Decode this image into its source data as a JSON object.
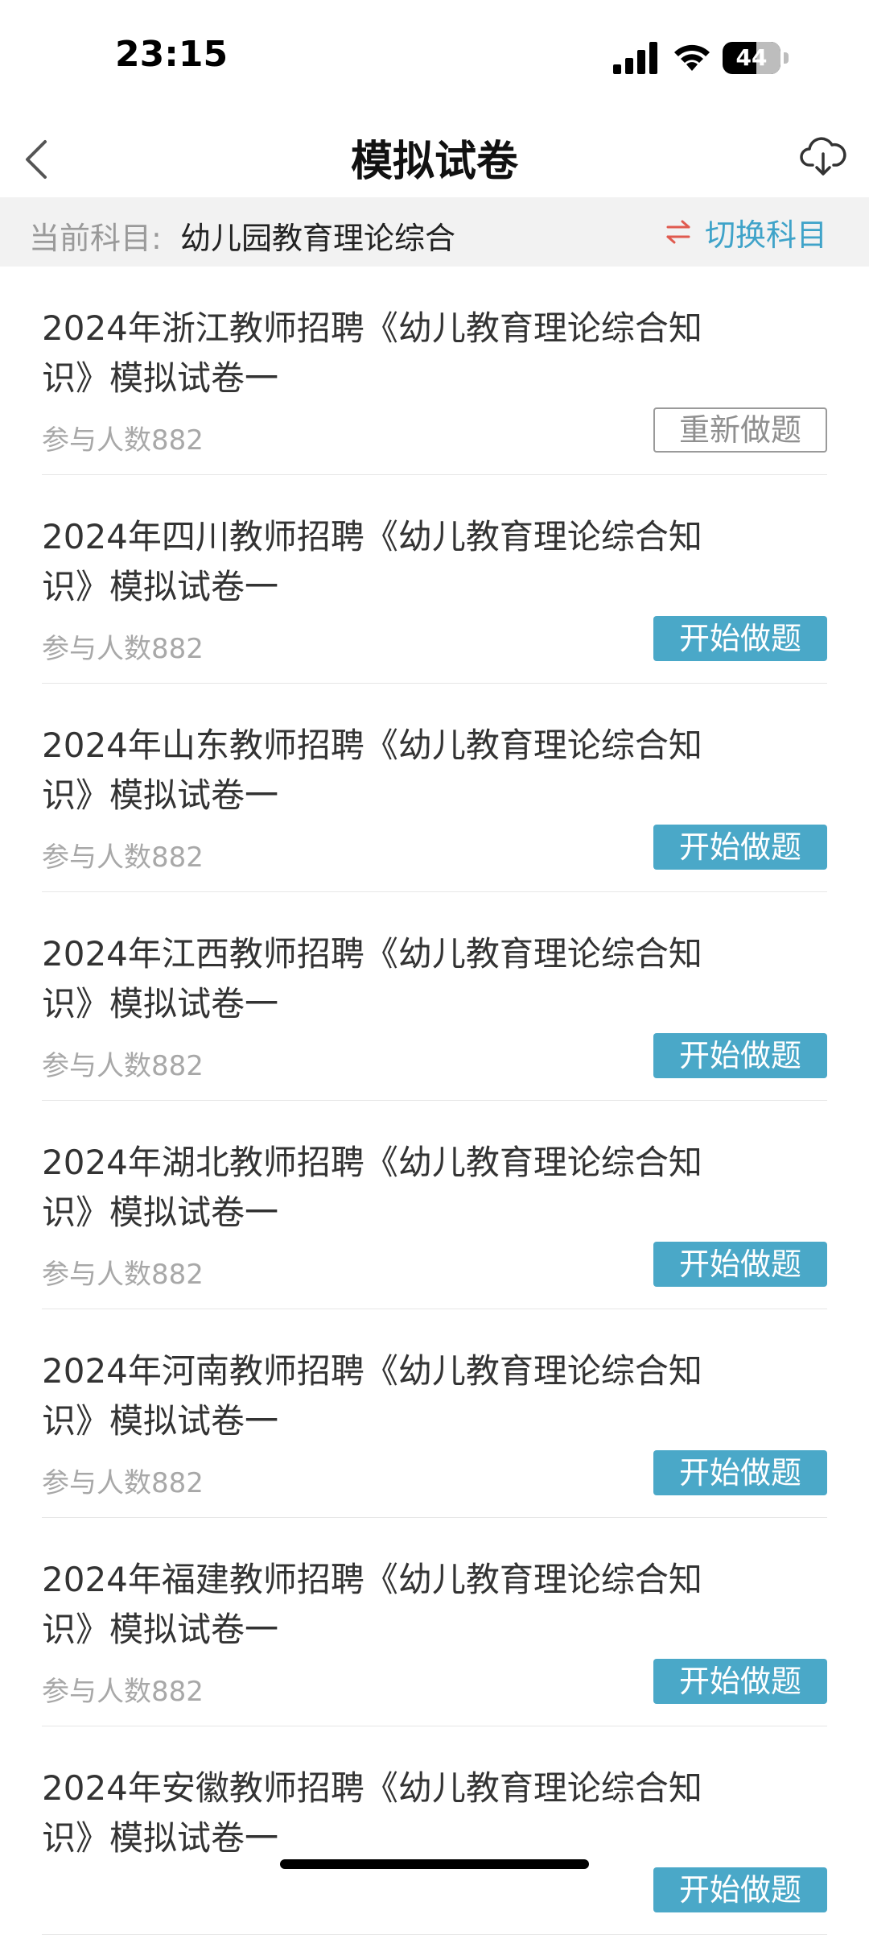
{
  "status_bar": {
    "time": "23:15",
    "battery_percent": "44"
  },
  "nav": {
    "title": "模拟试卷",
    "back_icon": "chevron-left-icon",
    "download_icon": "cloud-download-icon"
  },
  "subject": {
    "label": "当前科目:",
    "value": "幼儿园教育理论综合",
    "switch_label": "切换科目",
    "switch_icon": "swap-arrows-icon"
  },
  "papers": [
    {
      "title": "2024年浙江教师招聘《幼儿教育理论综合知识》模拟试卷一",
      "count": "参与人数882",
      "button": "重新做题",
      "state": "redo"
    },
    {
      "title": "2024年四川教师招聘《幼儿教育理论综合知识》模拟试卷一",
      "count": "参与人数882",
      "button": "开始做题",
      "state": "start"
    },
    {
      "title": "2024年山东教师招聘《幼儿教育理论综合知识》模拟试卷一",
      "count": "参与人数882",
      "button": "开始做题",
      "state": "start"
    },
    {
      "title": "2024年江西教师招聘《幼儿教育理论综合知识》模拟试卷一",
      "count": "参与人数882",
      "button": "开始做题",
      "state": "start"
    },
    {
      "title": "2024年湖北教师招聘《幼儿教育理论综合知识》模拟试卷一",
      "count": "参与人数882",
      "button": "开始做题",
      "state": "start"
    },
    {
      "title": "2024年河南教师招聘《幼儿教育理论综合知识》模拟试卷一",
      "count": "参与人数882",
      "button": "开始做题",
      "state": "start"
    },
    {
      "title": "2024年福建教师招聘《幼儿教育理论综合知识》模拟试卷一",
      "count": "参与人数882",
      "button": "开始做题",
      "state": "start"
    },
    {
      "title": "2024年安徽教师招聘《幼儿教育理论综合知识》模拟试卷一",
      "count": "",
      "button": "开始做题",
      "state": "start"
    }
  ],
  "colors": {
    "accent": "#4aa8c8",
    "switch_arrow_red": "#e05a4f",
    "subject_bar_bg": "#f2f2f2"
  }
}
